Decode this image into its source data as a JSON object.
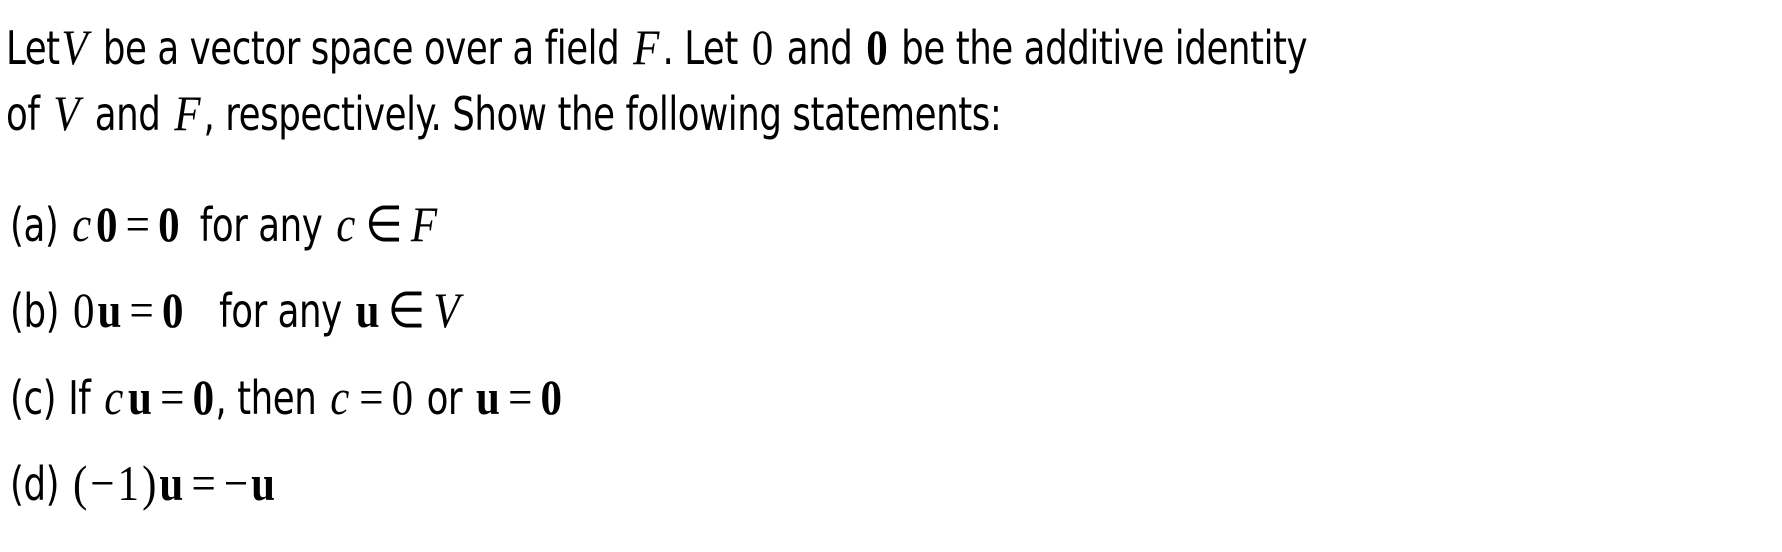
{
  "document": {
    "intro": {
      "line1": {
        "t1": "Let",
        "V": "V",
        "t2": "be a vector space over a field",
        "F": "F",
        "t3": ".  Let",
        "zero": "0",
        "t4": "and",
        "zero_bold": "0",
        "t5": "be the additive identity"
      },
      "line2": {
        "t1": "of",
        "V": "V",
        "t2": "and",
        "F": "F",
        "t3": ", respectively.  Show the following statements:"
      }
    },
    "items": {
      "a": {
        "label": "(a)",
        "c": "c",
        "zero_bold": "0",
        "eq": "=",
        "zero_bold_2": "0",
        "text": "for any",
        "c2": "c",
        "in": "∈",
        "F": "F"
      },
      "b": {
        "label": "(b)",
        "zero": "0",
        "u": "u",
        "eq": "=",
        "zero_bold": "0",
        "text": "for any",
        "u2": "u",
        "in": "∈",
        "V": "V"
      },
      "c": {
        "label": "(c)",
        "text1": "If",
        "c": "c",
        "u": "u",
        "eq": "=",
        "zero_bold": "0",
        "text2": ", then",
        "c2": "c",
        "eq2": "=",
        "zero": "0",
        "text3": "or",
        "u2": "u",
        "eq3": "=",
        "zero_bold_2": "0"
      },
      "d": {
        "label": "(d)",
        "lparen": "(",
        "minus": "−",
        "one": "1",
        "rparen": ")",
        "u": "u",
        "eq": "=",
        "minus2": "−",
        "u2": "u"
      }
    }
  }
}
